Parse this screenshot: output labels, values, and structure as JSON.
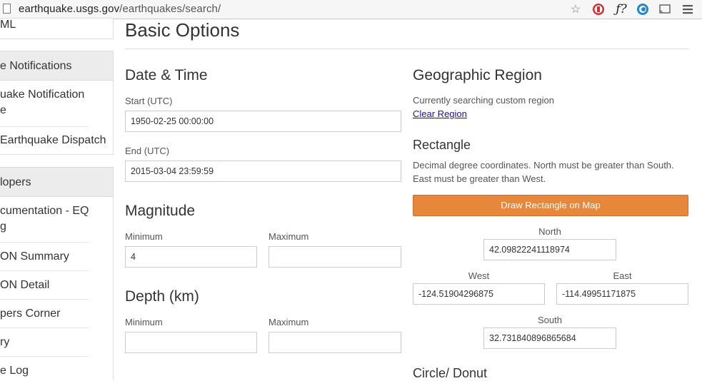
{
  "browser": {
    "url_domain": "earthquake.usgs.gov",
    "url_path": "/earthquakes/search/"
  },
  "sidebar": {
    "partial_top_item": "ML",
    "section_notifications": "e Notifications",
    "notif_items": [
      "uake Notification",
      "e",
      "Earthquake Dispatch"
    ],
    "section_developers": "lopers",
    "dev_items": [
      "cumentation - EQ",
      "g",
      "ON Summary",
      "ON Detail",
      "pers Corner",
      "ry",
      "e Log"
    ]
  },
  "main": {
    "title": "Basic Options",
    "datetime": {
      "heading": "Date & Time",
      "start_label": "Start (UTC)",
      "start_value": "1950-02-25 00:00:00",
      "end_label": "End (UTC)",
      "end_value": "2015-03-04 23:59:59"
    },
    "magnitude": {
      "heading": "Magnitude",
      "min_label": "Minimum",
      "max_label": "Maximum",
      "min_value": "4",
      "max_value": ""
    },
    "depth": {
      "heading": "Depth (km)",
      "min_label": "Minimum",
      "max_label": "Maximum",
      "min_value": "",
      "max_value": ""
    },
    "geo": {
      "heading": "Geographic Region",
      "status": "Currently searching custom region",
      "clear_link": "Clear Region",
      "rect_heading": "Rectangle",
      "rect_help_line1": "Decimal degree coordinates. North must be greater than South.",
      "rect_help_line2": "East must be greater than West.",
      "draw_button": "Draw Rectangle on Map",
      "north_label": "North",
      "north_value": "42.09822241118974",
      "west_label": "West",
      "west_value": "-124.51904296875",
      "east_label": "East",
      "east_value": "-114.49951171875",
      "south_label": "South",
      "south_value": "32.731840896865684",
      "circle_heading": "Circle/ Donut"
    }
  },
  "colors": {
    "accent": "#e6873c",
    "link": "#1a0dab"
  }
}
